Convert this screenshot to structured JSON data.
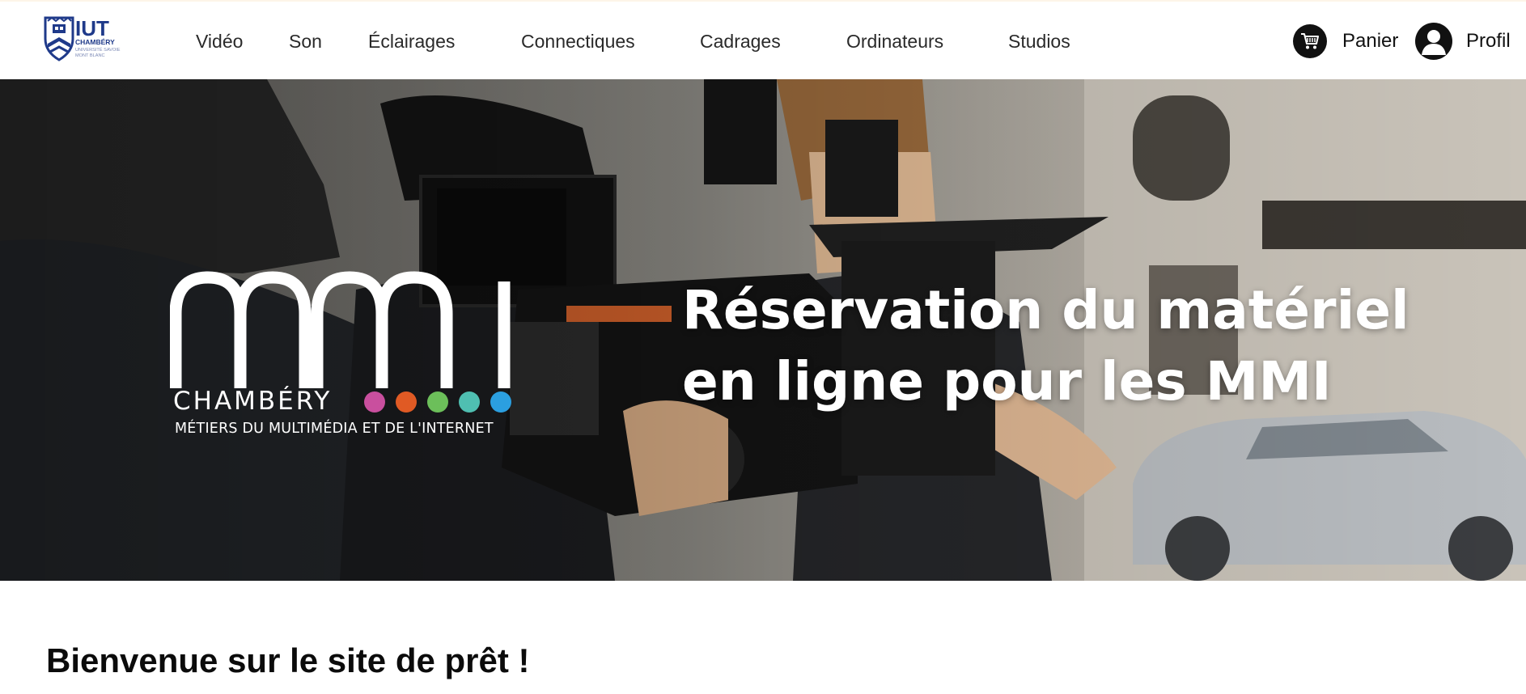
{
  "header": {
    "logo": {
      "text_main": "IUT",
      "text_city": "CHAMBÉRY",
      "text_univ_1": "UNIVERSITÉ SAVOIE",
      "text_univ_2": "MONT BLANC",
      "icon": "iut-shield-logo",
      "color": "#1f3a8a"
    },
    "nav": [
      {
        "label": "Vidéo"
      },
      {
        "label": "Son"
      },
      {
        "label": "Éclairages"
      },
      {
        "label": "Connectiques"
      },
      {
        "label": "Cadrages"
      },
      {
        "label": "Ordinateurs"
      },
      {
        "label": "Studios"
      }
    ],
    "cart": {
      "label": "Panier",
      "icon": "cart-icon"
    },
    "profile": {
      "label": "Profil",
      "icon": "user-icon"
    }
  },
  "hero": {
    "logo_word": "mmi",
    "logo_city": "CHAMBÉRY",
    "logo_subtitle": "MÉTIERS DU MULTIMÉDIA ET DE L'INTERNET",
    "logo_dot_colors": [
      "#c94f9e",
      "#e05a24",
      "#6cbf5a",
      "#4fbfb1",
      "#2b9fe0"
    ],
    "title_line_1": "Réservation du matériel",
    "title_line_2": "en ligne pour les MMI",
    "background": "photo-film-crew-camera"
  },
  "main": {
    "welcome_title": "Bienvenue sur le site de prêt !"
  }
}
